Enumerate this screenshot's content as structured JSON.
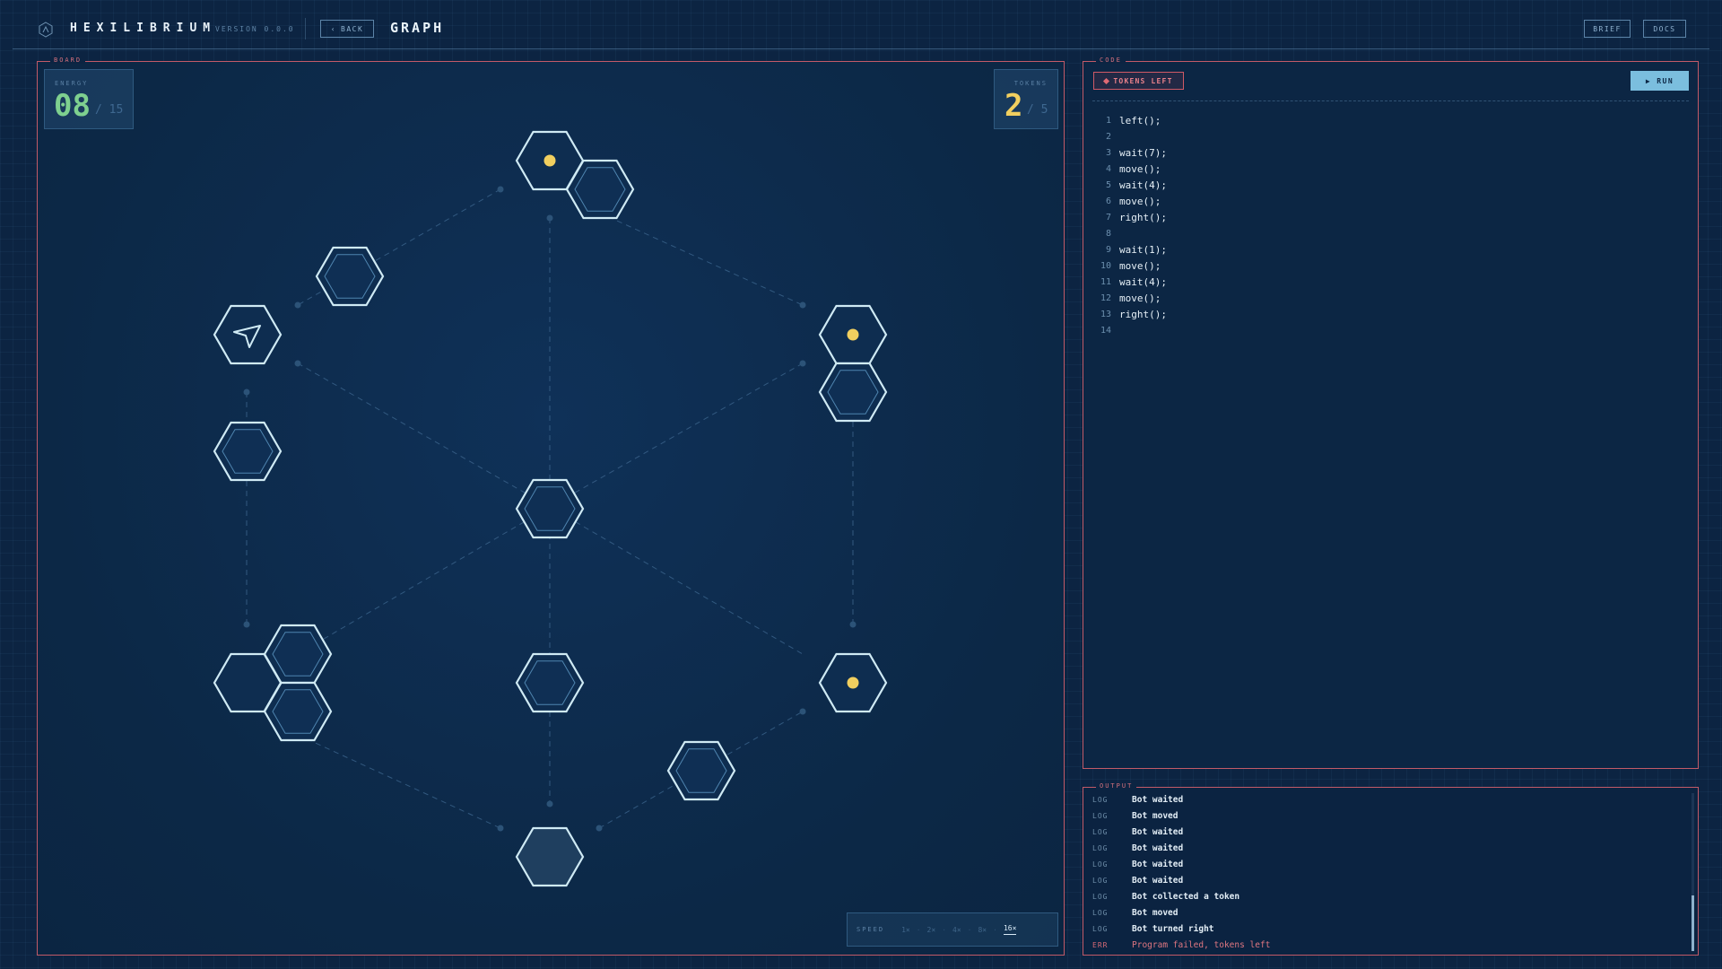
{
  "header": {
    "app_title": "HEXILIBRIUM",
    "version": "VERSION 0.0.0",
    "back_label": "BACK",
    "page_title": "GRAPH",
    "brief_label": "BRIEF",
    "docs_label": "DOCS"
  },
  "board": {
    "label": "BOARD",
    "energy": {
      "label": "ENERGY",
      "value": "08",
      "max": "/ 15"
    },
    "tokens": {
      "label": "TOKENS",
      "value": "2",
      "max": "/ 5"
    },
    "speed": {
      "label": "SPEED",
      "options": [
        "1×",
        "2×",
        "4×",
        "8×",
        "16×"
      ],
      "selected": "16×"
    }
  },
  "code": {
    "label": "CODE",
    "status_badge": "TOKENS LEFT",
    "run_label": "RUN",
    "lines": [
      {
        "n": "1",
        "text": "left();"
      },
      {
        "n": "2",
        "text": ""
      },
      {
        "n": "3",
        "text": "wait(7);"
      },
      {
        "n": "4",
        "text": "move();"
      },
      {
        "n": "5",
        "text": "wait(4);"
      },
      {
        "n": "6",
        "text": "move();"
      },
      {
        "n": "7",
        "text": "right();"
      },
      {
        "n": "8",
        "text": ""
      },
      {
        "n": "9",
        "text": "wait(1);"
      },
      {
        "n": "10",
        "text": "move();"
      },
      {
        "n": "11",
        "text": "wait(4);"
      },
      {
        "n": "12",
        "text": "move();"
      },
      {
        "n": "13",
        "text": "right();"
      },
      {
        "n": "14",
        "text": ""
      }
    ]
  },
  "output": {
    "label": "OUTPUT",
    "entries": [
      {
        "tag": "LOG",
        "msg": "Bot waited"
      },
      {
        "tag": "LOG",
        "msg": "Bot moved"
      },
      {
        "tag": "LOG",
        "msg": "Bot waited"
      },
      {
        "tag": "LOG",
        "msg": "Bot waited"
      },
      {
        "tag": "LOG",
        "msg": "Bot waited"
      },
      {
        "tag": "LOG",
        "msg": "Bot waited"
      },
      {
        "tag": "LOG",
        "msg": "Bot collected a token"
      },
      {
        "tag": "LOG",
        "msg": "Bot moved"
      },
      {
        "tag": "LOG",
        "msg": "Bot turned right"
      },
      {
        "tag": "ERR",
        "msg": "Program failed, tokens left"
      }
    ]
  },
  "colors": {
    "accent_red": "#c25a68",
    "energy_green": "#7ed08f",
    "token_yellow": "#f1cf5f",
    "run_blue": "#7bbede",
    "hex_stroke": "#cfeaf4"
  }
}
